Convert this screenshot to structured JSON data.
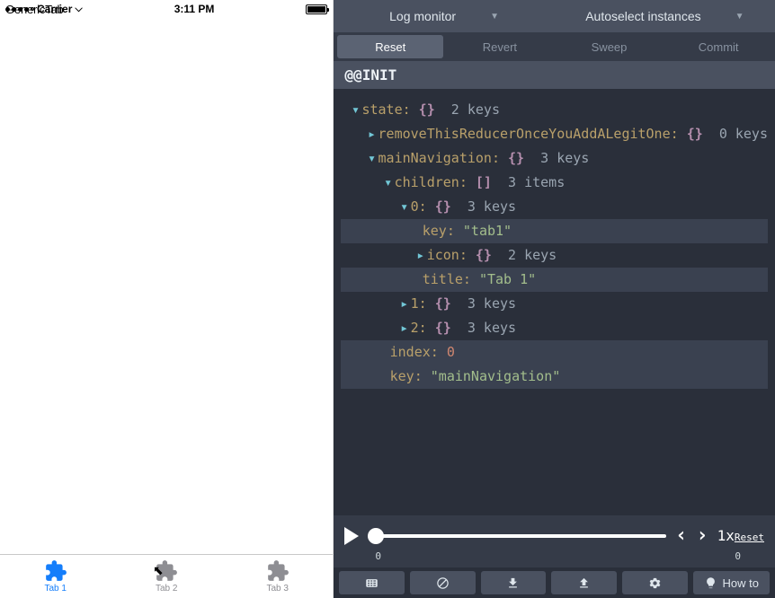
{
  "phone": {
    "carrier": "Carrier",
    "wifi_icon": "wifi",
    "time": "3:11 PM",
    "nav_title": "GenericTab",
    "tabs": [
      {
        "label": "Tab 1",
        "active": true
      },
      {
        "label": "Tab 2",
        "active": false
      },
      {
        "label": "Tab 3",
        "active": false
      }
    ]
  },
  "devtools": {
    "dropdowns": {
      "left": "Log monitor",
      "right": "Autoselect instances"
    },
    "buttons": {
      "reset": "Reset",
      "revert": "Revert",
      "sweep": "Sweep",
      "commit": "Commit"
    },
    "action_label": "@@INIT",
    "tree": {
      "state_key": "state:",
      "state_braces": "{}",
      "state_meta": "2 keys",
      "remove_key": "removeThisReducerOnceYouAddALegitOne:",
      "remove_meta": "0 keys",
      "mainnav_key": "mainNavigation:",
      "mainnav_meta": "3 keys",
      "children_key": "children:",
      "children_braces": "[]",
      "children_meta": "3 items",
      "idx0_key": "0:",
      "idx0_meta": "3 keys",
      "k_key": "key:",
      "k_val": "\"tab1\"",
      "icon_key": "icon:",
      "icon_meta": "2 keys",
      "title_key": "title:",
      "title_val": "\"Tab 1\"",
      "idx1_key": "1:",
      "idx1_meta": "3 keys",
      "idx2_key": "2:",
      "idx2_meta": "3 keys",
      "index_key": "index:",
      "index_val": "0",
      "navkey_key": "key:",
      "navkey_val": "\"mainNavigation\""
    },
    "player": {
      "speed": "1x",
      "reset": "Reset",
      "tick_start": "0",
      "tick_end": "0"
    },
    "bottom": {
      "howto": "How to"
    }
  }
}
